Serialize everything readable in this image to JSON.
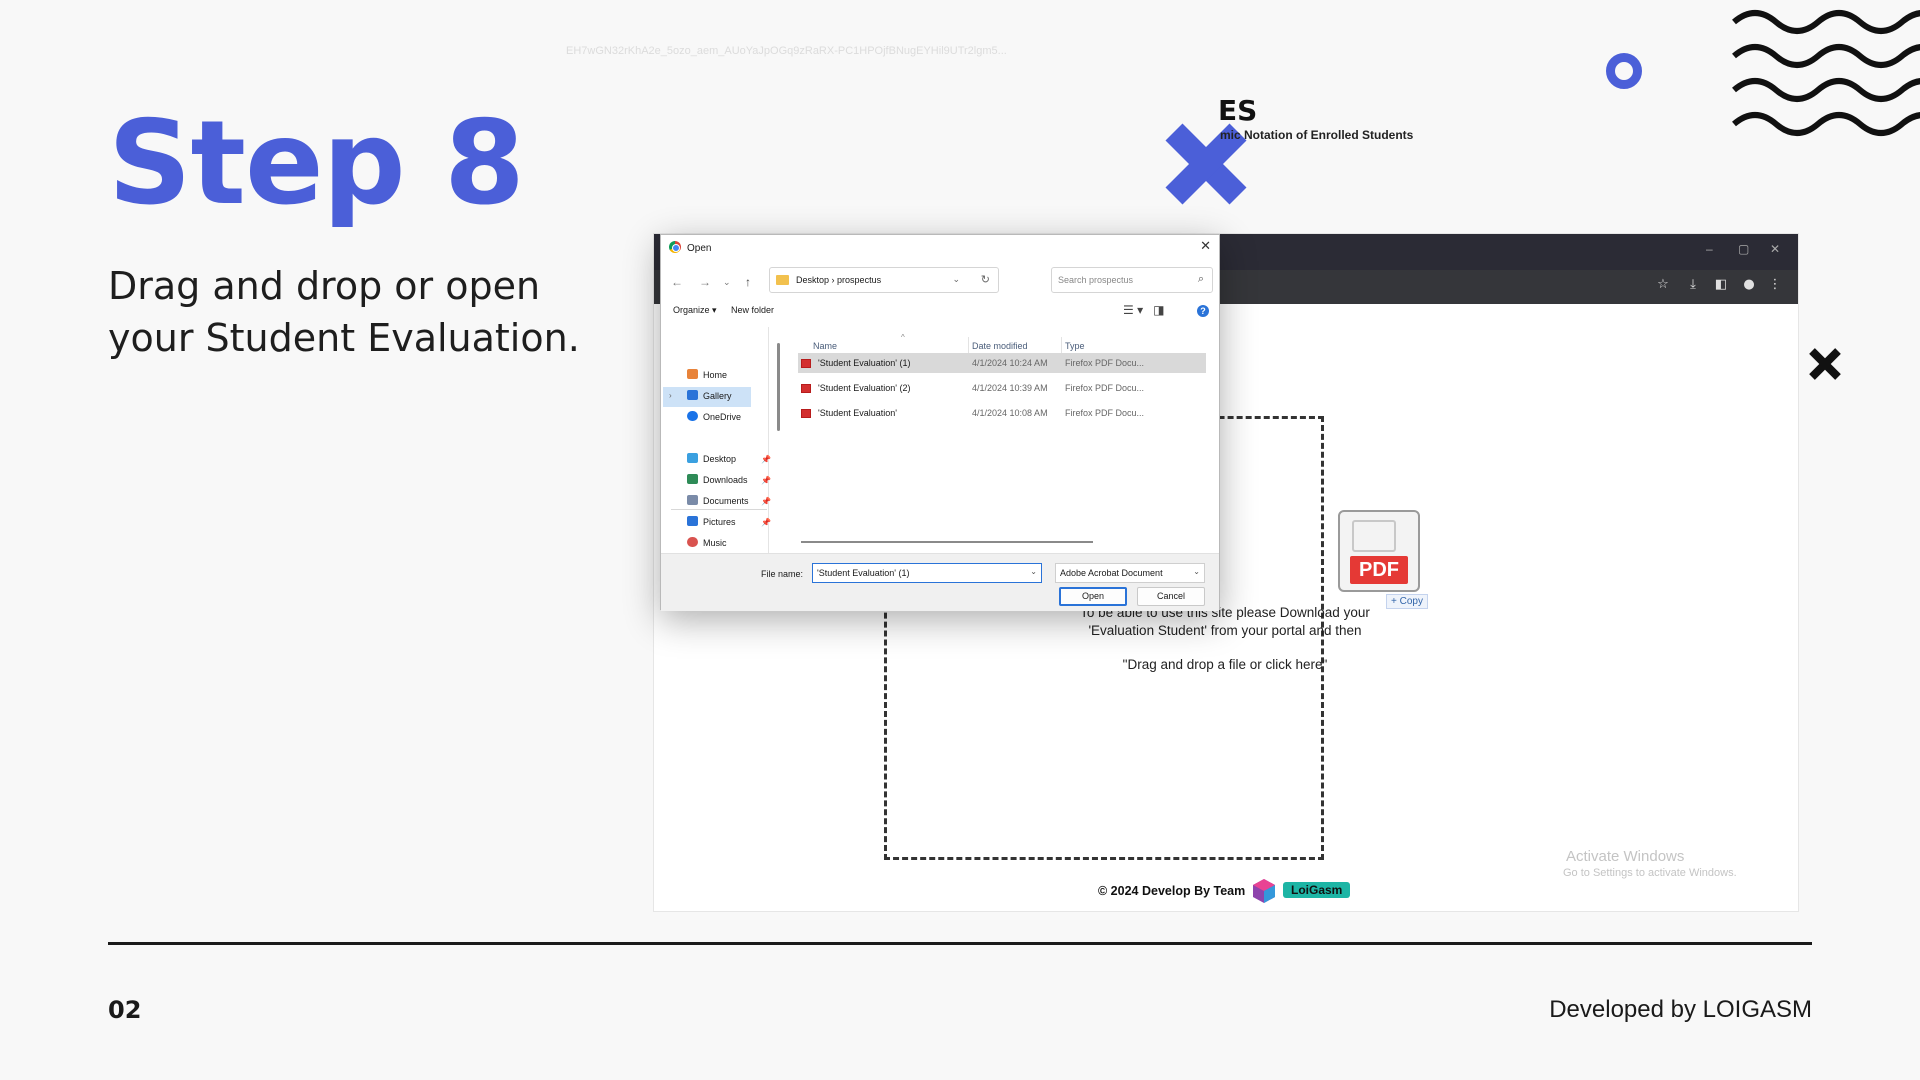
{
  "slide": {
    "title": "Step 8",
    "description": "Drag and drop or open your Student Evaluation.",
    "page_number": "02",
    "credit": "Developed by LOIGASM",
    "accent_color": "#4b5fd8"
  },
  "browser": {
    "url_text": "EH7wGN32rKhA2e_5ozo_aem_AUoYaJpOGq9zRaRX-PC1HPOjfBNugEYHil9UTr2lgm5...",
    "window_controls": [
      "–",
      "▢",
      "✕"
    ],
    "toolbar_icons": [
      "star-icon",
      "download-icon",
      "sidepanel-icon",
      "profile-icon",
      "more-icon"
    ],
    "page_heading": "ES",
    "page_subheading": "mic Notation of Enrolled Students",
    "pdf_badge": "PDF",
    "copy_label": "+ Copy",
    "instructions": "To be able to use this site please Download your 'Evaluation Student' from your portal and then",
    "drag_text": "\"Drag and drop a file or click here\"",
    "watermark_title": "Activate Windows",
    "watermark_sub": "Go to Settings to activate Windows.",
    "footer_text": "© 2024 Develop By  Team",
    "footer_badge": "LoiGasm"
  },
  "dialog": {
    "title": "Open",
    "path": [
      "Desktop",
      "prospectus"
    ],
    "search_placeholder": "Search prospectus",
    "organize_label": "Organize ▾",
    "new_folder_label": "New folder",
    "nav_items": [
      {
        "label": "Home",
        "icon": "home-icon",
        "color": "#e8833a"
      },
      {
        "label": "Gallery",
        "icon": "gallery-icon",
        "color": "#2a73d8"
      },
      {
        "label": "OneDrive",
        "icon": "cloud-icon",
        "color": "#1a73e8"
      },
      {
        "label": "Desktop",
        "icon": "desktop-icon",
        "color": "#3aa0e0"
      },
      {
        "label": "Downloads",
        "icon": "download-icon",
        "color": "#2e8b57"
      },
      {
        "label": "Documents",
        "icon": "documents-icon",
        "color": "#7a8ba8"
      },
      {
        "label": "Pictures",
        "icon": "pictures-icon",
        "color": "#2a73d8"
      },
      {
        "label": "Music",
        "icon": "music-icon",
        "color": "#d9534f"
      }
    ],
    "columns": [
      "Name",
      "Date modified",
      "Type"
    ],
    "files": [
      {
        "name": "'Student Evaluation' (1)",
        "date": "4/1/2024 10:24 AM",
        "type": "Firefox PDF Docu..."
      },
      {
        "name": "'Student Evaluation' (2)",
        "date": "4/1/2024 10:39 AM",
        "type": "Firefox PDF Docu..."
      },
      {
        "name": "'Student Evaluation'",
        "date": "4/1/2024 10:08 AM",
        "type": "Firefox PDF Docu..."
      }
    ],
    "file_name_label": "File name:",
    "file_name_value": "'Student Evaluation' (1)",
    "file_type_value": "Adobe Acrobat Document",
    "open_label": "Open",
    "cancel_label": "Cancel"
  }
}
